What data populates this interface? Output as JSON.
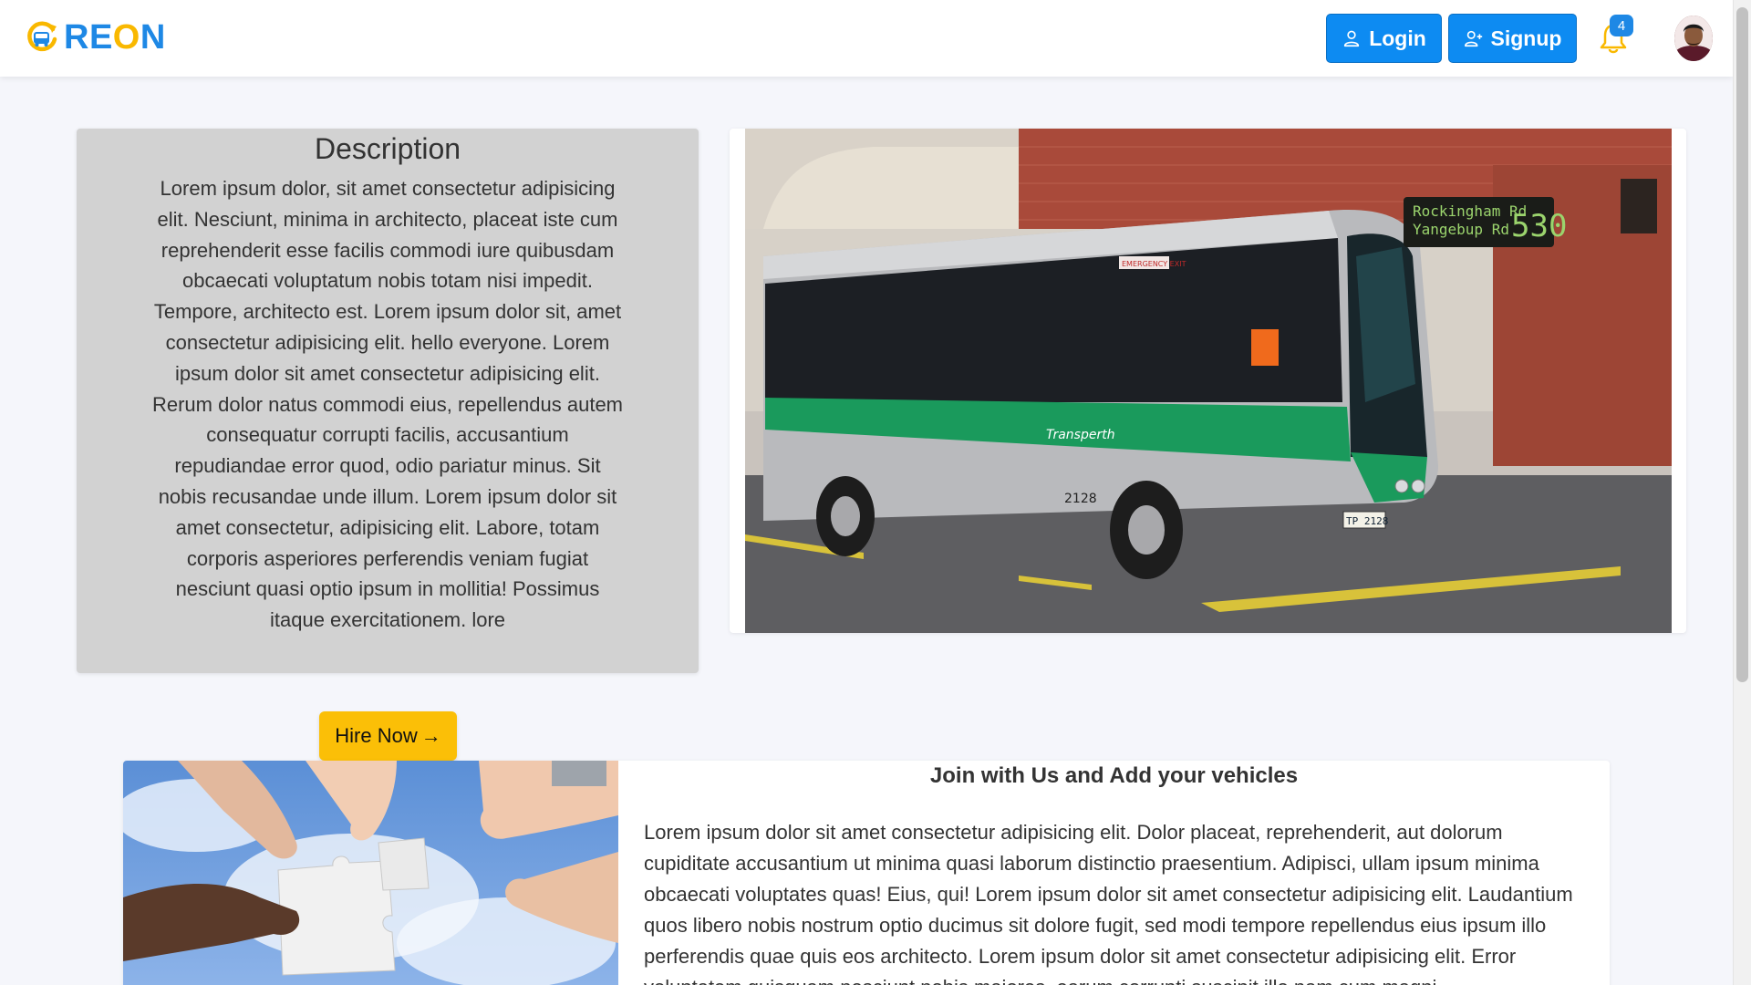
{
  "brand": {
    "name_part1": "RE",
    "name_part2": "O",
    "name_part3": "N",
    "logo_icon": "bus-refresh-icon",
    "primary_color": "#1e88e5",
    "accent_color": "#f9b800"
  },
  "nav": {
    "login_label": "Login",
    "login_icon": "user-icon",
    "signup_label": "Signup",
    "signup_icon": "user-plus-icon",
    "notification_icon": "bell-icon",
    "notification_count": "4",
    "avatar_icon": "user-avatar"
  },
  "description": {
    "title": "Description",
    "text": "Lorem ipsum dolor, sit amet consectetur adipisicing elit. Nesciunt, minima in architecto, placeat iste cum reprehenderit esse facilis commodi iure quibusdam obcaecati voluptatum nobis totam nisi impedit. Tempore, architecto est. Lorem ipsum dolor sit, amet consectetur adipisicing elit. hello everyone. Lorem ipsum dolor sit amet consectetur adipisicing elit. Rerum dolor natus commodi eius, repellendus autem consequatur corrupti facilis, accusantium repudiandae error quod, odio pariatur minus. Sit nobis recusandae unde illum. Lorem ipsum dolor sit amet consectetur, adipisicing elit. Labore, totam corporis asperiores perferendis veniam fugiat nesciunt quasi optio ipsum in mollitia! Possimus itaque exercitationem. lore"
  },
  "bus_image": {
    "destination_line1": "Rockingham Rd",
    "destination_line2": "Yangebup Rd",
    "route_number": "530",
    "fleet_number": "2128",
    "plate": "TP 2128",
    "operator": "Transperth",
    "emergency_label": "EMERGENCY EXIT"
  },
  "hire": {
    "label": "Hire Now",
    "arrow": "→",
    "color": "#fbbf07"
  },
  "join": {
    "title": "Join with Us and Add your vehicles",
    "text": "Lorem ipsum dolor sit amet consectetur adipisicing elit. Dolor placeat, reprehenderit, aut dolorum cupiditate accusantium ut minima quasi laborum distinctio praesentium. Adipisci, ullam ipsum minima obcaecati voluptates quas! Eius, qui! Lorem ipsum dolor sit amet consectetur adipisicing elit. Laudantium quos libero nobis nostrum optio ducimus sit dolore fugit, sed modi tempore repellendus eius ipsum illo perferendis quae quis eos architecto. Lorem ipsum dolor sit amet consectetur adipisicing elit. Error voluptatem quisquam nesciunt nobis maiores, earum corrupti suscipit illo nam cum magni"
  }
}
